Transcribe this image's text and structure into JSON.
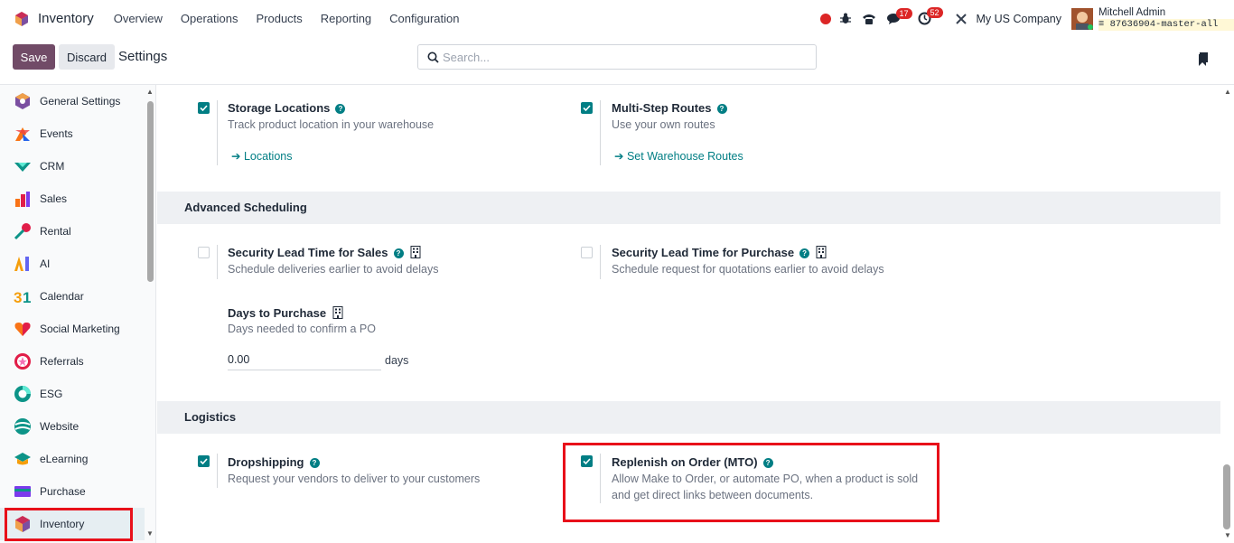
{
  "navbar": {
    "app_name": "Inventory",
    "menu": [
      "Overview",
      "Operations",
      "Products",
      "Reporting",
      "Configuration"
    ],
    "messages_badge": "17",
    "activities_badge": "52",
    "company": "My US Company",
    "user_name": "Mitchell Admin",
    "db_name": "87636904-master-all"
  },
  "control": {
    "save_label": "Save",
    "discard_label": "Discard",
    "title": "Settings",
    "search_placeholder": "Search..."
  },
  "sidebar": {
    "items": [
      {
        "label": "General Settings",
        "icon": "general-settings-icon"
      },
      {
        "label": "Events",
        "icon": "events-icon"
      },
      {
        "label": "CRM",
        "icon": "crm-icon"
      },
      {
        "label": "Sales",
        "icon": "sales-icon"
      },
      {
        "label": "Rental",
        "icon": "rental-icon"
      },
      {
        "label": "AI",
        "icon": "ai-icon"
      },
      {
        "label": "Calendar",
        "icon": "calendar-icon"
      },
      {
        "label": "Social Marketing",
        "icon": "social-marketing-icon"
      },
      {
        "label": "Referrals",
        "icon": "referrals-icon"
      },
      {
        "label": "ESG",
        "icon": "esg-icon"
      },
      {
        "label": "Website",
        "icon": "website-icon"
      },
      {
        "label": "eLearning",
        "icon": "elearning-icon"
      },
      {
        "label": "Purchase",
        "icon": "purchase-icon"
      },
      {
        "label": "Inventory",
        "icon": "inventory-icon"
      }
    ],
    "active": "Inventory"
  },
  "main": {
    "storage": {
      "title": "Storage Locations",
      "desc": "Track product location in your warehouse",
      "link": "Locations",
      "checked": true
    },
    "routes": {
      "title": "Multi-Step Routes",
      "desc": "Use your own routes",
      "link": "Set Warehouse Routes",
      "checked": true
    },
    "advanced_scheduling": "Advanced Scheduling",
    "lead_sales": {
      "title": "Security Lead Time for Sales",
      "desc": "Schedule deliveries earlier to avoid delays",
      "checked": false
    },
    "lead_purchase": {
      "title": "Security Lead Time for Purchase",
      "desc": "Schedule request for quotations earlier to avoid delays",
      "checked": false
    },
    "days_purchase": {
      "title": "Days to Purchase",
      "desc": "Days needed to confirm a PO",
      "value": "0.00",
      "unit": "days"
    },
    "logistics": "Logistics",
    "dropshipping": {
      "title": "Dropshipping",
      "desc": "Request your vendors to deliver to your customers",
      "checked": true
    },
    "mto": {
      "title": "Replenish on Order (MTO)",
      "desc_line1": "Allow Make to Order, or automate PO, when a product is sold",
      "desc_line2": "and get direct links between documents.",
      "checked": true
    }
  },
  "colors": {
    "brand": "#714b67",
    "accent": "#017e84",
    "highlight": "#e8101a"
  }
}
